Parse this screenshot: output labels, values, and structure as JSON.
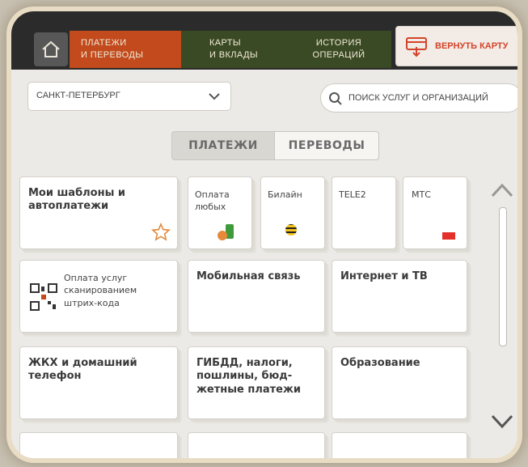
{
  "top_nav": {
    "tabs": [
      {
        "line1": "ПЛАТЕЖИ",
        "line2": "И ПЕРЕВОДЫ"
      },
      {
        "line1": "КАРТЫ",
        "line2": "И ВКЛАДЫ"
      },
      {
        "line1": "ИСТОРИЯ",
        "line2": "ОПЕРАЦИЙ"
      }
    ],
    "return_card_label": "ВЕРНУТЬ КАРТУ"
  },
  "city_select": {
    "value": "САНКТ-ПЕТЕРБУРГ"
  },
  "search": {
    "placeholder": "ПОИСК УСЛУГ И ОРГАНИЗАЦИЙ"
  },
  "segments": {
    "payments": "ПЛАТЕЖИ",
    "transfers": "ПЕРЕВОДЫ"
  },
  "tiles": {
    "templates": "Мои шаблоны и автоплатежи",
    "pay_any": "Оплата любых",
    "beeline": "Билайн",
    "tele2": "TELE2",
    "mts": "МТС",
    "scan_pay": "Оплата услуг сканированием штрих-кода",
    "mobile": "Мобильная связь",
    "internet_tv": "Интернет и ТВ",
    "utilities": "ЖКХ и домашний телефон",
    "gibdd": "ГИБДД, налоги, пошлины, бюд-жетные платежи",
    "education": "Образование"
  },
  "colors": {
    "active_tab": "#c24a1c",
    "inactive_tab": "#3a4a24",
    "accent_red": "#d2442a",
    "star": "#e08a3c"
  },
  "icons": [
    "home-icon",
    "card-return-icon",
    "chevron-down-icon",
    "search-icon",
    "star-icon",
    "qr-code-icon",
    "chevron-up-icon"
  ]
}
